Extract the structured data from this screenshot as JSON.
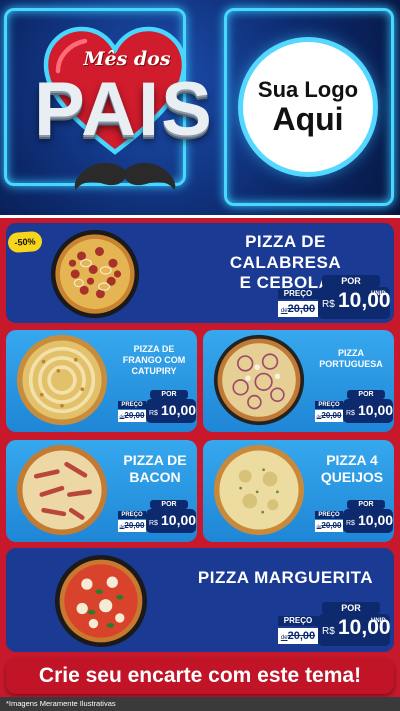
{
  "header": {
    "banner_line1": "Mês dos",
    "banner_line2": "PAIS",
    "logo_line1": "Sua Logo",
    "logo_line2": "Aqui"
  },
  "badge": {
    "discount": "-50%"
  },
  "price_labels": {
    "por": "POR",
    "preco": "PREÇO",
    "currency": "R$",
    "unid": "UNID",
    "old_prefix": "de",
    "old_value": "20,00",
    "new_value": "10,00"
  },
  "products": [
    {
      "name_line1": "PIZZA DE CALABRESA",
      "name_line2": "E CEBOLA"
    },
    {
      "name_line1": "PIZZA DE",
      "name_line2": "FRANGO COM",
      "name_line3": "CATUPIRY"
    },
    {
      "name_line1": "PIZZA",
      "name_line2": "PORTUGUESA"
    },
    {
      "name_line1": "PIZZA DE",
      "name_line2": "BACON"
    },
    {
      "name_line1": "PIZZA 4",
      "name_line2": "QUEIJOS"
    },
    {
      "name_line1": "PIZZA MARGUERITA"
    }
  ],
  "cta": "Crie seu encarte com este tema!",
  "footnote": "*Imagens Meramente Ilustrativas",
  "colors": {
    "header_blue": "#0d2a6e",
    "neon": "#48d8ff",
    "panel_red": "#c8182c",
    "card_blue": "#1b3a94",
    "card_light": "#2e9be6",
    "badge_yellow": "#f7d51d"
  }
}
